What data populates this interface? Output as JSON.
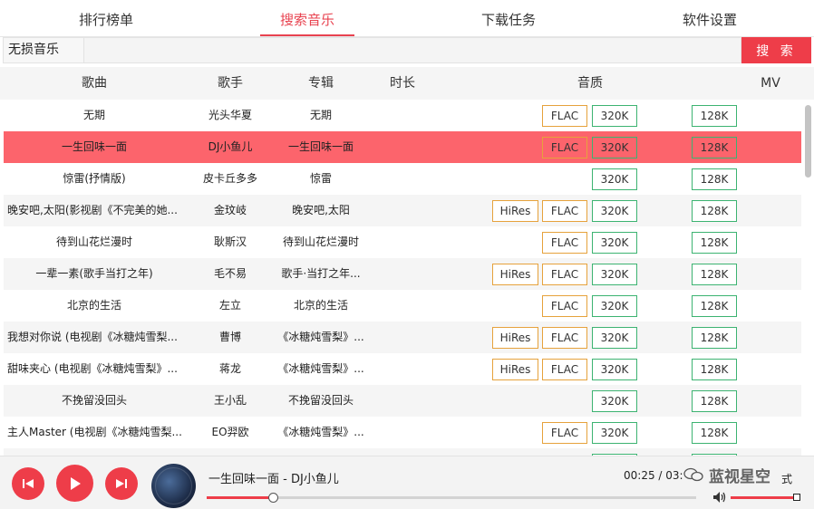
{
  "tabs": [
    "排行榜单",
    "搜索音乐",
    "下载任务",
    "软件设置"
  ],
  "active_tab": "搜索音乐",
  "search": {
    "tag": "无损音乐",
    "query": "",
    "button": "搜 索"
  },
  "columns": {
    "song": "歌曲",
    "singer": "歌手",
    "album": "专辑",
    "duration": "时长",
    "quality": "音质",
    "mv": "MV"
  },
  "quality_labels": {
    "hires": "HiRes",
    "flac": "FLAC",
    "k320": "320K",
    "k128": "128K"
  },
  "songs": [
    {
      "title": "无期",
      "singer": "光头华夏",
      "album": "无期",
      "hires": false,
      "flac": true,
      "k320": true,
      "k128": true
    },
    {
      "title": "一生回味一面",
      "singer": "DJ小鱼儿",
      "album": "一生回味一面",
      "hires": false,
      "flac": true,
      "k320": true,
      "k128": true,
      "highlighted": true
    },
    {
      "title": "惊雷(抒情版)",
      "singer": "皮卡丘多多",
      "album": "惊雷",
      "hires": false,
      "flac": false,
      "k320": true,
      "k128": true
    },
    {
      "title": "晚安吧,太阳(影视剧《不完美的她...",
      "singer": "金玟岐",
      "album": "晚安吧,太阳",
      "hires": true,
      "flac": true,
      "k320": true,
      "k128": true
    },
    {
      "title": "待到山花烂漫时",
      "singer": "耿斯汉",
      "album": "待到山花烂漫时",
      "hires": false,
      "flac": true,
      "k320": true,
      "k128": true
    },
    {
      "title": "一辈一素(歌手当打之年)",
      "singer": "毛不易",
      "album": "歌手·当打之年...",
      "hires": true,
      "flac": true,
      "k320": true,
      "k128": true
    },
    {
      "title": "北京的生活",
      "singer": "左立",
      "album": "北京的生活",
      "hires": false,
      "flac": true,
      "k320": true,
      "k128": true
    },
    {
      "title": "我想对你说 (电视剧《冰糖炖雪梨...",
      "singer": "曹博",
      "album": "《冰糖炖雪梨》...",
      "hires": true,
      "flac": true,
      "k320": true,
      "k128": true
    },
    {
      "title": "甜味夹心 (电视剧《冰糖炖雪梨》...",
      "singer": "蒋龙",
      "album": "《冰糖炖雪梨》...",
      "hires": true,
      "flac": true,
      "k320": true,
      "k128": true
    },
    {
      "title": "不挽留没回头",
      "singer": "王小乱",
      "album": "不挽留没回头",
      "hires": false,
      "flac": false,
      "k320": true,
      "k128": true
    },
    {
      "title": "主人Master (电视剧《冰糖炖雪梨...",
      "singer": "EO羿欧",
      "album": "《冰糖炖雪梨》...",
      "hires": false,
      "flac": true,
      "k320": true,
      "k128": true
    },
    {
      "title": "",
      "singer": "",
      "album": "",
      "hires": false,
      "flac": false,
      "k320": true,
      "k128": true
    }
  ],
  "player": {
    "now_playing": "一生回味一面 - DJ小鱼儿",
    "time": "00:25 / 03:",
    "mode": "式",
    "progress_fraction": 0.135,
    "volume_fraction": 0.95,
    "watermark": "蓝视星空"
  },
  "colors": {
    "accent": "#ee3d49",
    "highlight_row": "#fc646c",
    "hq_border": "#e6a23c",
    "std_border": "#3cb371"
  }
}
